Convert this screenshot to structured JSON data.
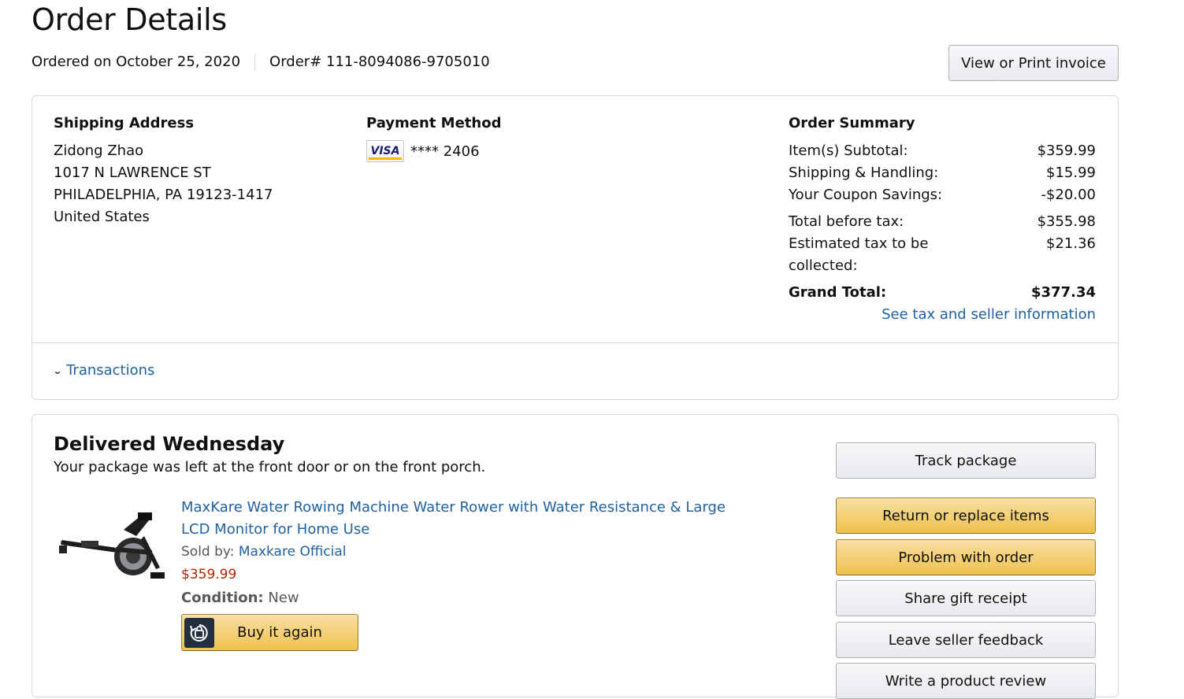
{
  "header": {
    "title": "Order Details",
    "ordered_on": "Ordered on October 25, 2020",
    "order_number": "Order# 111-8094086-9705010",
    "invoice_button": "View or Print invoice"
  },
  "shipping": {
    "heading": "Shipping Address",
    "lines": [
      "Zidong Zhao",
      "1017 N LAWRENCE ST",
      "PHILADELPHIA, PA 19123-1417",
      "United States"
    ]
  },
  "payment": {
    "heading": "Payment Method",
    "card_brand": "VISA",
    "card_number": "**** 2406"
  },
  "summary": {
    "heading": "Order Summary",
    "rows": [
      {
        "label": "Item(s) Subtotal:",
        "value": "$359.99"
      },
      {
        "label": "Shipping & Handling:",
        "value": "$15.99"
      },
      {
        "label": "Your Coupon Savings:",
        "value": "-$20.00"
      },
      {
        "label": "Total before tax:",
        "value": "$355.98"
      },
      {
        "label": "Estimated tax to be collected:",
        "value": "$21.36"
      },
      {
        "label": "Grand Total:",
        "value": "$377.34"
      }
    ],
    "tax_link": "See tax and seller information"
  },
  "transactions_link": "Transactions",
  "delivery": {
    "status": "Delivered Wednesday",
    "note": "Your package was left at the front door or on the front porch.",
    "product": {
      "title": "MaxKare Water Rowing Machine Water Rower with Water Resistance & Large LCD Monitor for Home Use",
      "sold_by_label": "Sold by:",
      "seller": "Maxkare Official",
      "price": "$359.99",
      "condition_label": "Condition:",
      "condition": "New",
      "buy_again": "Buy it again"
    },
    "actions": [
      "Track package",
      "Return or replace items",
      "Problem with order",
      "Share gift receipt",
      "Leave seller feedback",
      "Write a product review"
    ]
  },
  "colors": {
    "link": "#2162a1",
    "price": "#B12704",
    "primary_button": "#f0c14b"
  }
}
